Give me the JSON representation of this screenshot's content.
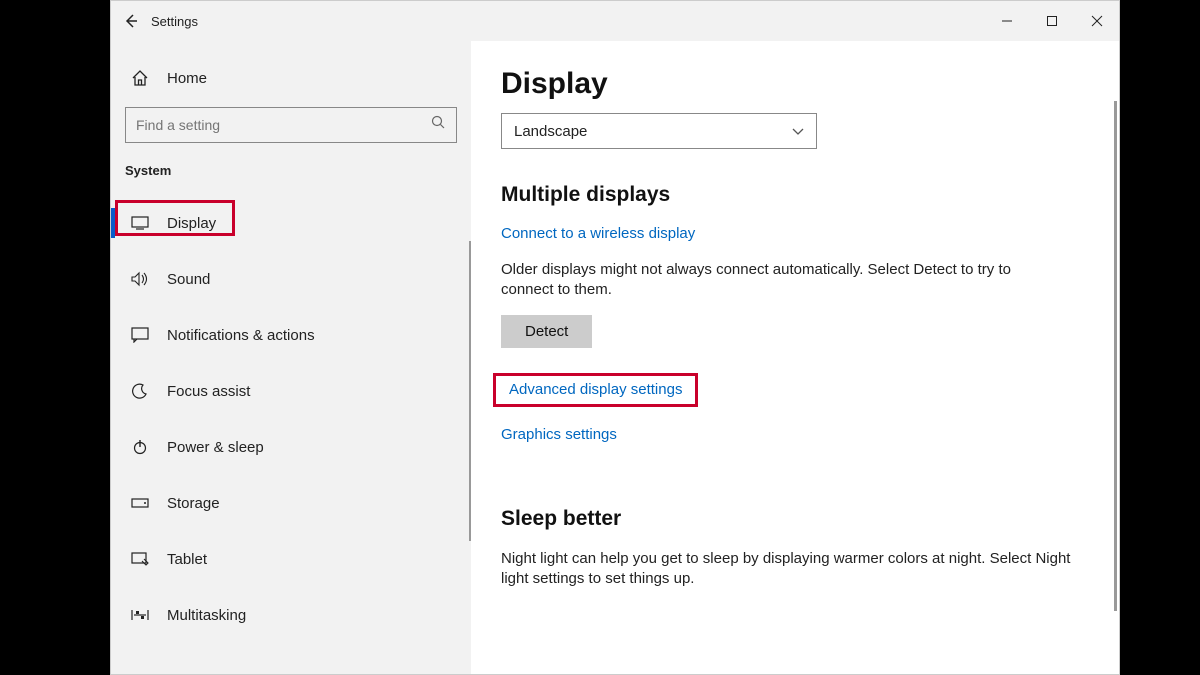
{
  "window": {
    "title": "Settings"
  },
  "sidebar": {
    "home": "Home",
    "search_placeholder": "Find a setting",
    "group": "System",
    "items": [
      {
        "label": "Display"
      },
      {
        "label": "Sound"
      },
      {
        "label": "Notifications & actions"
      },
      {
        "label": "Focus assist"
      },
      {
        "label": "Power & sleep"
      },
      {
        "label": "Storage"
      },
      {
        "label": "Tablet"
      },
      {
        "label": "Multitasking"
      }
    ]
  },
  "content": {
    "page_title": "Display",
    "orientation_value": "Landscape",
    "multiple_heading": "Multiple displays",
    "wireless_link": "Connect to a wireless display",
    "detect_desc": "Older displays might not always connect automatically. Select Detect to try to connect to them.",
    "detect_button": "Detect",
    "advanced_link": "Advanced display settings",
    "graphics_link": "Graphics settings",
    "sleep_heading": "Sleep better",
    "sleep_desc": "Night light can help you get to sleep by displaying warmer colors at night. Select Night light settings to set things up."
  }
}
